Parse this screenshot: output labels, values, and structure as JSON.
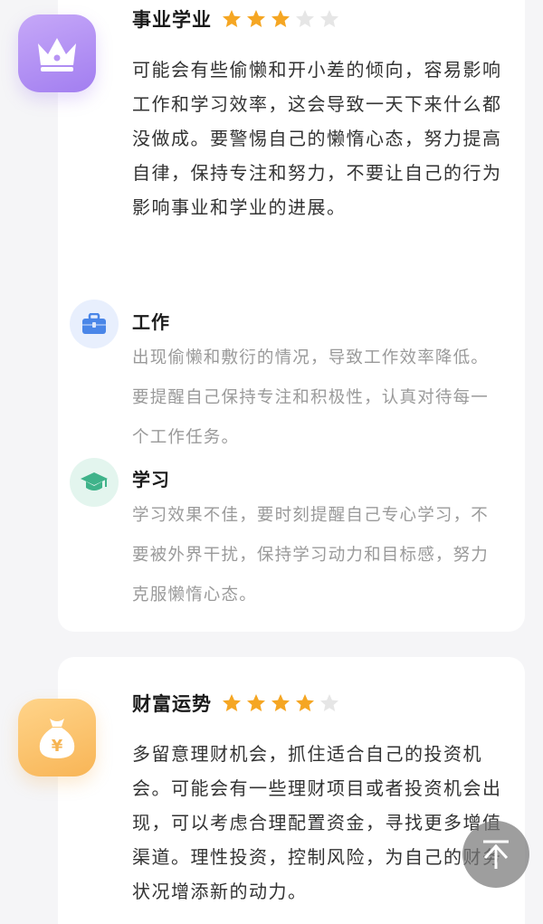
{
  "career": {
    "title": "事业学业",
    "rating": 3,
    "max_rating": 5,
    "description": "可能会有些偷懒和开小差的倾向，容易影响工作和学习效率，这会导致一天下来什么都没做成。要警惕自己的懒惰心态，努力提高自律，保持专注和努力，不要让自己的行为影响事业和学业的进展。",
    "icon": "crown-icon",
    "work": {
      "title": "工作",
      "icon": "briefcase-icon",
      "text": "出现偷懒和敷衍的情况，导致工作效率降低。要提醒自己保持专注和积极性，认真对待每一个工作任务。"
    },
    "study": {
      "title": "学习",
      "icon": "graduation-cap-icon",
      "text": "学习效果不佳，要时刻提醒自己专心学习，不要被外界干扰，保持学习动力和目标感，努力克服懒惰心态。"
    }
  },
  "wealth": {
    "title": "财富运势",
    "rating": 4,
    "max_rating": 5,
    "description": "多留意理财机会，抓住适合自己的投资机会。可能会有一些理财项目或者投资机会出现，可以考虑合理配置资金，寻找更多增值渠道。理性投资，控制风险，为自己的财务状况增添新的动力。",
    "icon": "money-bag-icon"
  },
  "colors": {
    "star_filled": "#f5a623",
    "star_empty": "#e6e6e6",
    "career_icon": "#a27ef0",
    "wealth_icon": "#f8b556",
    "work_icon_bg": "#e8effd",
    "study_icon_bg": "#e3f5ee"
  },
  "scroll_top_icon": "arrow-up-icon"
}
